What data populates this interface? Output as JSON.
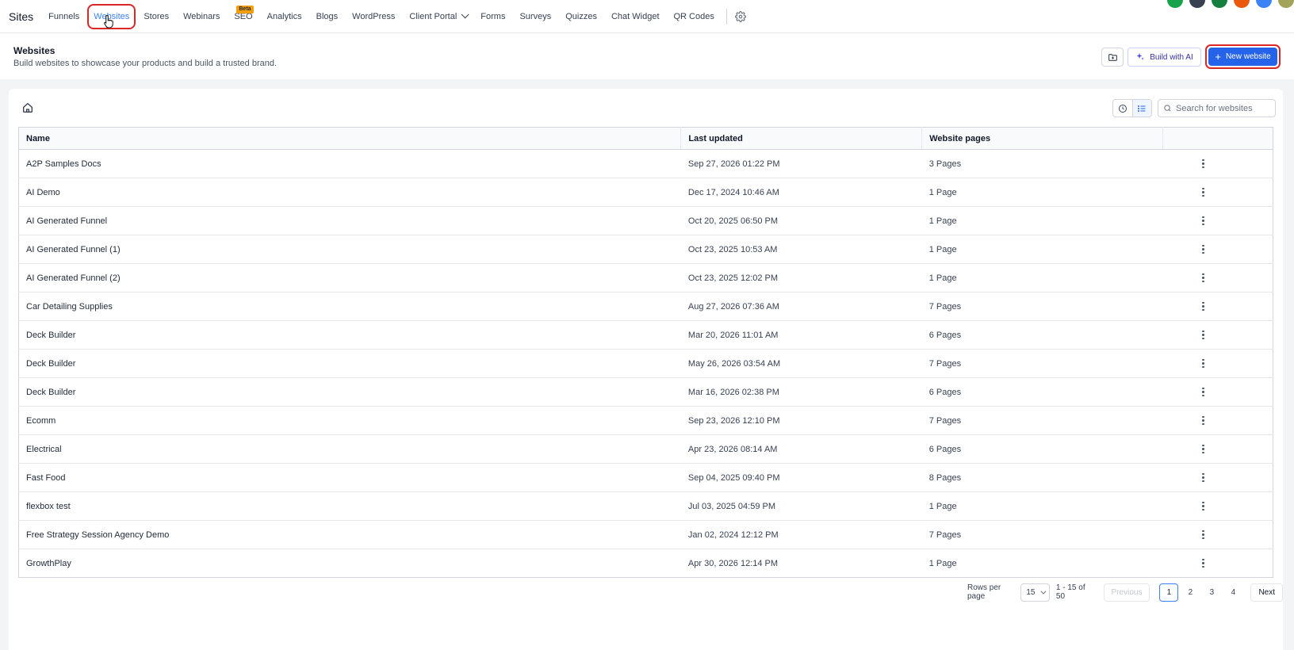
{
  "app": {
    "brand": "Sites"
  },
  "nav": {
    "items": [
      {
        "label": "Funnels",
        "name": "nav-funnels"
      },
      {
        "label": "Websites",
        "name": "nav-websites",
        "active": true,
        "highlight": true
      },
      {
        "label": "Stores",
        "name": "nav-stores"
      },
      {
        "label": "Webinars",
        "name": "nav-webinars"
      },
      {
        "label": "SEO",
        "name": "nav-seo",
        "badge": "Beta"
      },
      {
        "label": "Analytics",
        "name": "nav-analytics"
      },
      {
        "label": "Blogs",
        "name": "nav-blogs"
      },
      {
        "label": "WordPress",
        "name": "nav-wordpress"
      },
      {
        "label": "Client Portal",
        "name": "nav-client-portal",
        "dropdown": true
      },
      {
        "label": "Forms",
        "name": "nav-forms"
      },
      {
        "label": "Surveys",
        "name": "nav-surveys"
      },
      {
        "label": "Quizzes",
        "name": "nav-quizzes"
      },
      {
        "label": "Chat Widget",
        "name": "nav-chat-widget"
      },
      {
        "label": "QR Codes",
        "name": "nav-qr-codes"
      }
    ],
    "settings_icon": "gear-icon",
    "avatar_colors": [
      "#16a34a",
      "#374151",
      "#15803d",
      "#ea580c",
      "#3b82f6",
      "#a3a35a"
    ]
  },
  "header": {
    "title": "Websites",
    "subtitle": "Build websites to showcase your products and build a trusted brand.",
    "new_folder_icon": "folder-plus-icon",
    "build_ai_label": "Build with AI",
    "new_website_label": "New website"
  },
  "toolbar": {
    "search_placeholder": "Search for websites"
  },
  "table": {
    "columns": [
      "Name",
      "Last updated",
      "Website pages"
    ],
    "rows": [
      {
        "name": "A2P Samples Docs",
        "updated": "Sep 27, 2026 01:22 PM",
        "pages": "3 Pages"
      },
      {
        "name": "AI Demo",
        "updated": "Dec 17, 2024 10:46 AM",
        "pages": "1 Page"
      },
      {
        "name": "AI Generated Funnel",
        "updated": "Oct 20, 2025 06:50 PM",
        "pages": "1 Page"
      },
      {
        "name": "AI Generated Funnel (1)",
        "updated": "Oct 23, 2025 10:53 AM",
        "pages": "1 Page"
      },
      {
        "name": "AI Generated Funnel (2)",
        "updated": "Oct 23, 2025 12:02 PM",
        "pages": "1 Page"
      },
      {
        "name": "Car Detailing Supplies",
        "updated": "Aug 27, 2026 07:36 AM",
        "pages": "7 Pages"
      },
      {
        "name": "Deck Builder",
        "updated": "Mar 20, 2026 11:01 AM",
        "pages": "6 Pages"
      },
      {
        "name": "Deck Builder",
        "updated": "May 26, 2026 03:54 AM",
        "pages": "7 Pages"
      },
      {
        "name": "Deck Builder",
        "updated": "Mar 16, 2026 02:38 PM",
        "pages": "6 Pages"
      },
      {
        "name": "Ecomm",
        "updated": "Sep 23, 2026 12:10 PM",
        "pages": "7 Pages"
      },
      {
        "name": "Electrical",
        "updated": "Apr 23, 2026 08:14 AM",
        "pages": "6 Pages"
      },
      {
        "name": "Fast Food",
        "updated": "Sep 04, 2025 09:40 PM",
        "pages": "8 Pages"
      },
      {
        "name": "flexbox test",
        "updated": "Jul 03, 2025 04:59 PM",
        "pages": "1 Page"
      },
      {
        "name": "Free Strategy Session Agency Demo",
        "updated": "Jan 02, 2024 12:12 PM",
        "pages": "7 Pages"
      },
      {
        "name": "GrowthPlay",
        "updated": "Apr 30, 2026 12:14 PM",
        "pages": "1 Page"
      }
    ]
  },
  "pagination": {
    "rows_per_page_label": "Rows per page",
    "rows_per_page": "15",
    "range": "1 - 15 of 50",
    "previous_label": "Previous",
    "pages": [
      "1",
      "2",
      "3",
      "4"
    ],
    "current_page": "1",
    "next_label": "Next"
  }
}
